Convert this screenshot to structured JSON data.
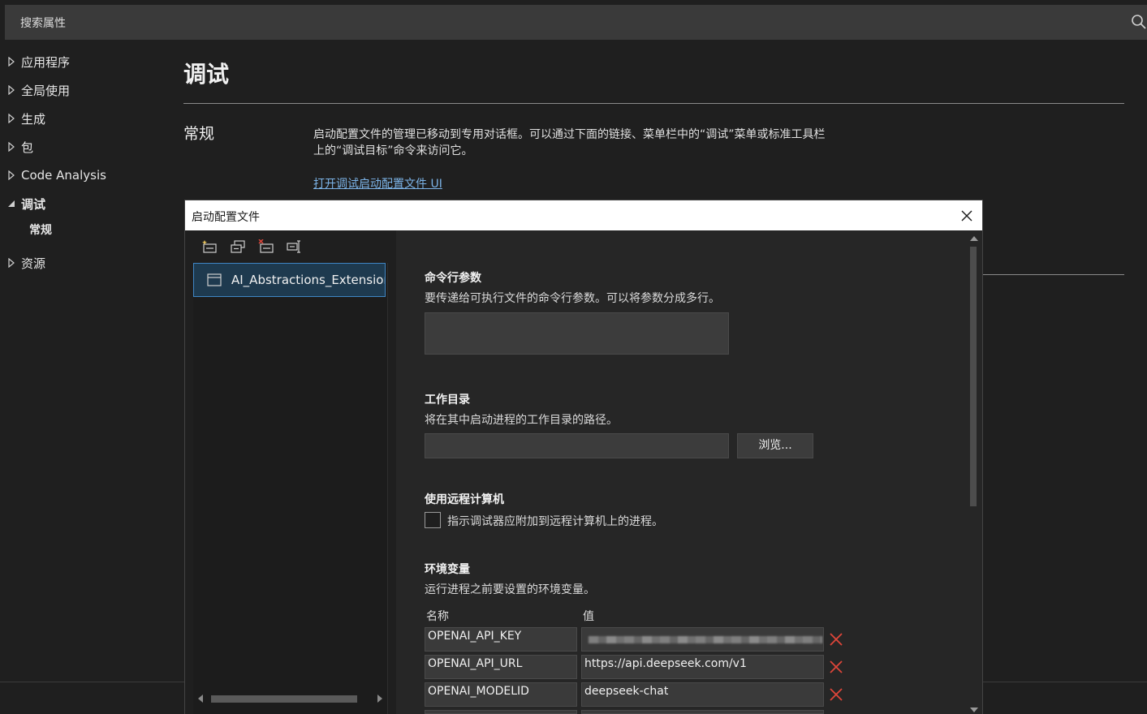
{
  "search": {
    "placeholder": "搜索属性",
    "icon": "search-icon"
  },
  "nav": {
    "items": [
      {
        "label": "应用程序",
        "expanded": false
      },
      {
        "label": "全局使用",
        "expanded": false
      },
      {
        "label": "生成",
        "expanded": false
      },
      {
        "label": "包",
        "expanded": false
      },
      {
        "label": "Code Analysis",
        "expanded": false
      },
      {
        "label": "调试",
        "expanded": true
      },
      {
        "label": "资源",
        "expanded": false
      }
    ],
    "sub_item": "常规"
  },
  "page": {
    "title": "调试",
    "section": "常规",
    "description": "启动配置文件的管理已移动到专用对话框。可以通过下面的链接、菜单栏中的“调试”菜单或标准工具栏上的“调试目标”命令来访问它。",
    "link": "打开调试启动配置文件 UI"
  },
  "dialog": {
    "title": "启动配置文件",
    "profiles": [
      "AI_Abstractions_Extensions"
    ],
    "command_args": {
      "title": "命令行参数",
      "desc": "要传递给可执行文件的命令行参数。可以将参数分成多行。",
      "value": ""
    },
    "working_dir": {
      "title": "工作目录",
      "desc": "将在其中启动进程的工作目录的路径。",
      "value": "",
      "browse_label": "浏览..."
    },
    "remote": {
      "title": "使用远程计算机",
      "checkbox_label": "指示调试器应附加到远程计算机上的进程。",
      "checked": false
    },
    "env": {
      "title": "环境变量",
      "desc": "运行进程之前要设置的环境变量。",
      "col_name": "名称",
      "col_value": "值",
      "rows": [
        {
          "name": "OPENAI_API_KEY",
          "value": ""
        },
        {
          "name": "OPENAI_API_URL",
          "value": "https://api.deepseek.com/v1"
        },
        {
          "name": "OPENAI_MODELID",
          "value": "deepseek-chat"
        }
      ]
    }
  },
  "colors": {
    "accent_link": "#7cb4e8",
    "delete_red": "#e0463a",
    "selection": "#1e3a4f"
  }
}
